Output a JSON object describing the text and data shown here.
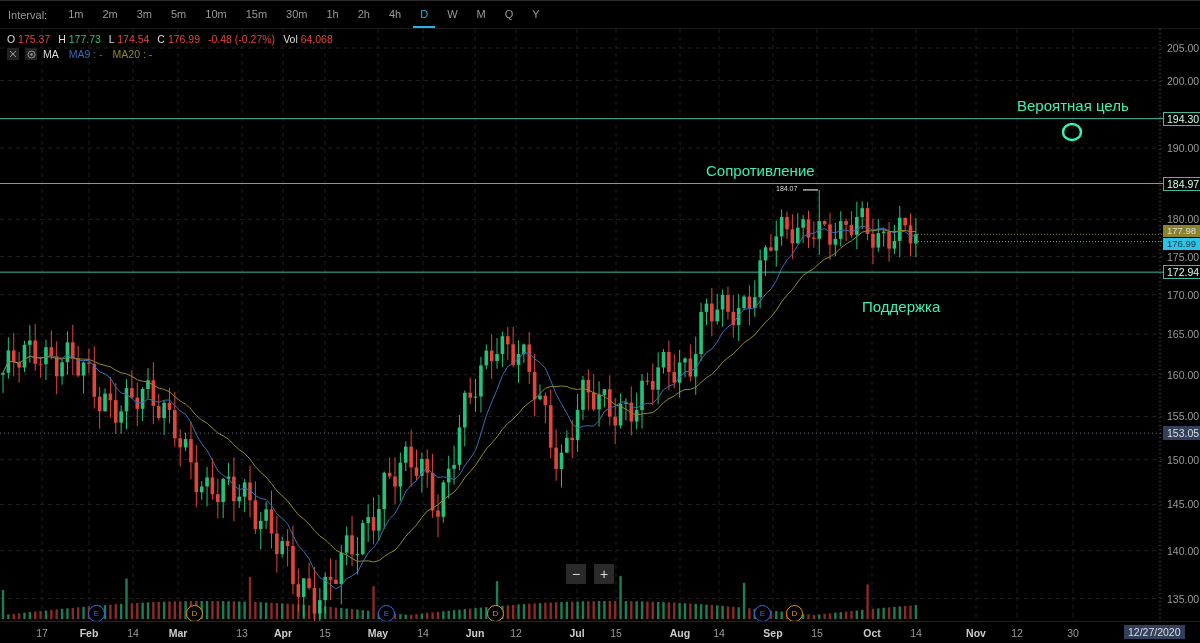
{
  "toolbar": {
    "label": "Interval:",
    "intervals": [
      {
        "label": "1m",
        "selected": false
      },
      {
        "label": "2m",
        "selected": false
      },
      {
        "label": "3m",
        "selected": false
      },
      {
        "label": "5m",
        "selected": false
      },
      {
        "label": "10m",
        "selected": false
      },
      {
        "label": "15m",
        "selected": false
      },
      {
        "label": "30m",
        "selected": false
      },
      {
        "label": "1h",
        "selected": false
      },
      {
        "label": "2h",
        "selected": false
      },
      {
        "label": "4h",
        "selected": false
      },
      {
        "label": "D",
        "selected": true
      },
      {
        "label": "W",
        "selected": false
      },
      {
        "label": "M",
        "selected": false
      },
      {
        "label": "Q",
        "selected": false
      },
      {
        "label": "Y",
        "selected": false
      }
    ]
  },
  "legend": {
    "items": [
      {
        "key": "O",
        "value": "175.37",
        "kind": "down"
      },
      {
        "key": "H",
        "value": "177.73",
        "kind": "up"
      },
      {
        "key": "L",
        "value": "174.54",
        "kind": "down"
      },
      {
        "key": "C",
        "value": "176.99",
        "kind": "down"
      }
    ],
    "change": "-0.48 (-0.27%)",
    "volume": {
      "key": "Vol",
      "value": "64,068"
    }
  },
  "indicators": {
    "name": "MA",
    "lines": [
      {
        "label": "MA9 : -",
        "color": "#3b6cb5"
      },
      {
        "label": "MA20 : -",
        "color": "#8d8a2e"
      }
    ]
  },
  "price_axis": {
    "ticks": [
      "205.00",
      "200.00",
      "190.00",
      "180.00",
      "175.00",
      "170.00",
      "165.00",
      "160.00",
      "155.00",
      "150.00",
      "145.00",
      "140.00",
      "135.00"
    ]
  },
  "levels": [
    {
      "label": "194.30"
    },
    {
      "label": "184.97"
    },
    {
      "label": "172.94"
    }
  ],
  "price_tags": [
    {
      "label": "177.98",
      "kind": "ma"
    },
    {
      "label": "176.99",
      "kind": "last"
    }
  ],
  "crosshair": {
    "price": "153.05",
    "date": "12/27/2020"
  },
  "annotations": [
    {
      "text": "Вероятная цель"
    },
    {
      "text": "Сопротивление"
    },
    {
      "text": "Поддержка"
    }
  ],
  "high_marker": "184.07",
  "events": [
    {
      "letter": "E",
      "kind": "earnings"
    },
    {
      "letter": "D",
      "kind": "dividend"
    },
    {
      "letter": "E",
      "kind": "earnings"
    },
    {
      "letter": "D",
      "kind": "dividend"
    },
    {
      "letter": "E",
      "kind": "earnings"
    },
    {
      "letter": "D",
      "kind": "dividend"
    }
  ],
  "zoom_controls": [
    "−",
    "+"
  ],
  "time_axis": [
    "17",
    "Feb",
    "14",
    "Mar",
    "13",
    "Apr",
    "15",
    "May",
    "14",
    "Jun",
    "12",
    "Jul",
    "15",
    "Aug",
    "14",
    "Sep",
    "15",
    "Oct",
    "14",
    "Nov",
    "12",
    "30"
  ]
}
